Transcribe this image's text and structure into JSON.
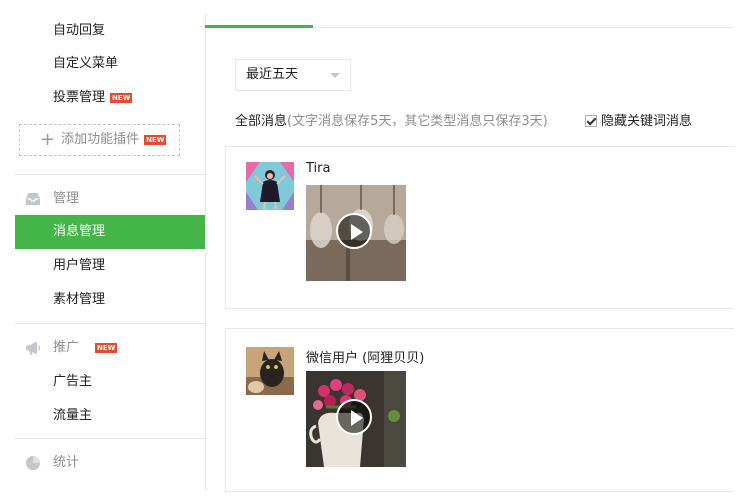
{
  "sidebar": {
    "top_items": [
      {
        "label": "自动回复"
      },
      {
        "label": "自定义菜单"
      },
      {
        "label": "投票管理",
        "badge": "NEW"
      }
    ],
    "add_plugin": {
      "label": "添加功能插件",
      "badge": "NEW"
    },
    "sections": [
      {
        "title": "管理",
        "icon": "inbox-icon",
        "items": [
          {
            "label": "消息管理",
            "active": true
          },
          {
            "label": "用户管理"
          },
          {
            "label": "素材管理"
          }
        ]
      },
      {
        "title": "推广",
        "icon": "megaphone-icon",
        "badge": "NEW",
        "items": [
          {
            "label": "广告主"
          },
          {
            "label": "流量主"
          }
        ]
      },
      {
        "title": "统计",
        "icon": "pie-chart-icon",
        "items": []
      }
    ]
  },
  "main": {
    "filter_dropdown": {
      "value": "最近五天"
    },
    "filter_text": {
      "label": "全部消息",
      "note": "(文字消息保存5天，其它类型消息只保存3天)"
    },
    "hide_keyword": {
      "label": "隐藏关键词消息",
      "checked": true
    },
    "messages": [
      {
        "sender": "Tira",
        "type": "video",
        "icon": "play-icon"
      },
      {
        "sender": "微信用户 (阿狸贝贝)",
        "type": "video",
        "icon": "play-icon"
      }
    ]
  },
  "colors": {
    "accent": "#44b549",
    "badge": "#e54c2b",
    "border": "#e4e8eb",
    "muted": "#8d8d8d"
  }
}
